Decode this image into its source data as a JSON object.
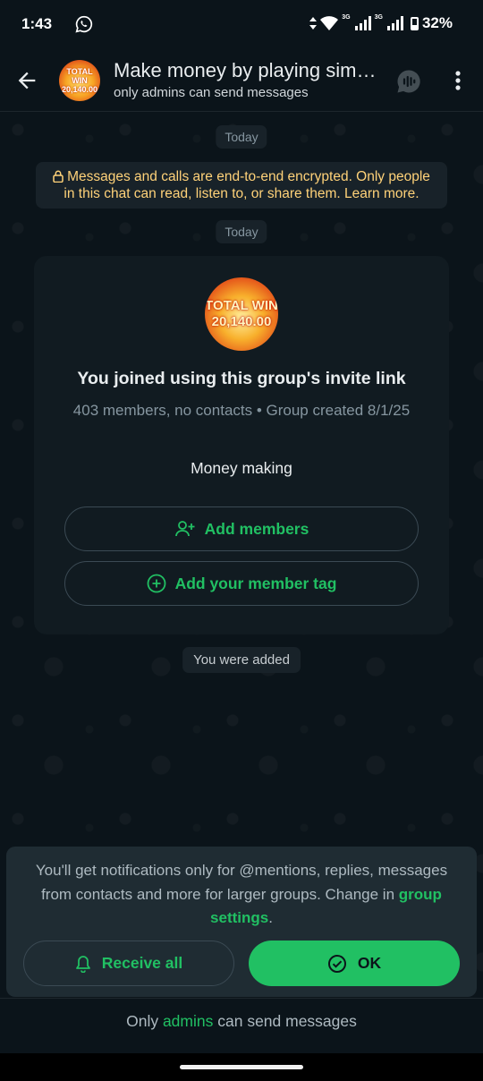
{
  "status_bar": {
    "time": "1:43",
    "battery": "32%",
    "network_label": "3G",
    "icons": [
      "whatsapp-icon",
      "data-arrows-icon",
      "wifi-icon",
      "signal-icon",
      "battery-icon"
    ]
  },
  "header": {
    "title": "Make money by playing simpl...",
    "subtitle": "only admins can send messages",
    "avatar_text": "TOTAL WIN 20,140.00"
  },
  "chat": {
    "date_chip_1": "Today",
    "encryption_notice": "Messages and calls are end-to-end encrypted. Only people in this chat can read, listen to, or share them. Learn more.",
    "date_chip_2": "Today",
    "intro_card": {
      "avatar_text": "TOTAL WIN 20,140.00",
      "heading": "You joined using this group's invite link",
      "meta": "403 members, no contacts • Group created 8/1/25",
      "description": "Money making",
      "add_members_label": "Add members",
      "member_tag_label": "Add your member tag"
    },
    "system_message": "You were added"
  },
  "notification_panel": {
    "text_before_link": "You'll get notifications only for @mentions, replies, messages from contacts and more for larger groups. Change in ",
    "link_text": "group settings",
    "text_after_link": ".",
    "receive_all_label": "Receive all",
    "ok_label": "OK"
  },
  "footer": {
    "prefix": "Only ",
    "admins_link": "admins",
    "suffix": " can send messages"
  },
  "colors": {
    "background": "#0b141a",
    "accent_green": "#21c063",
    "notice_yellow": "#ffd279",
    "card_bg": "#111b21",
    "panel_bg": "#1f2c33"
  }
}
